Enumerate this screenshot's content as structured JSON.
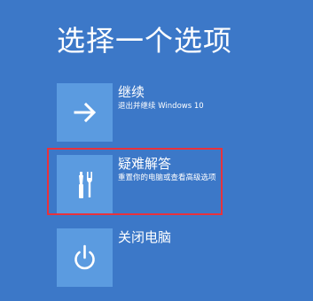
{
  "screen": {
    "title": "选择一个选项",
    "background_color": "#3c78c8",
    "tile_color": "#5b9be0",
    "highlight_color": "#e8323c"
  },
  "options": [
    {
      "name": "继续",
      "description": "退出并继续 Windows 10",
      "icon": "arrow-right-icon"
    },
    {
      "name": "疑难解答",
      "description": "重置你的电脑或查看高级选项",
      "icon": "tools-icon"
    },
    {
      "name": "关闭电脑",
      "description": "",
      "icon": "power-icon"
    }
  ]
}
